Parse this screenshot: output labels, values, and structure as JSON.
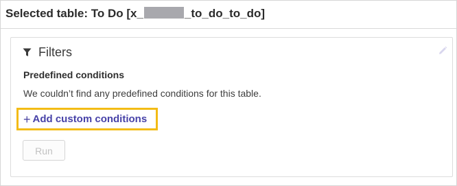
{
  "header": {
    "title_prefix": "Selected table: To Do [x_",
    "title_suffix": "_to_do_to_do]"
  },
  "filters": {
    "title": "Filters",
    "filter_icon": "funnel-icon",
    "edit_icon": "pencil-icon",
    "predefined_title": "Predefined conditions",
    "predefined_message": "We couldn’t find any predefined conditions for this table.",
    "add_plus": "+",
    "add_label": "Add custom conditions",
    "run_label": "Run"
  },
  "colors": {
    "highlight": "#f3bb15",
    "link": "#4742a8",
    "redaction": "#a8a8ad"
  }
}
